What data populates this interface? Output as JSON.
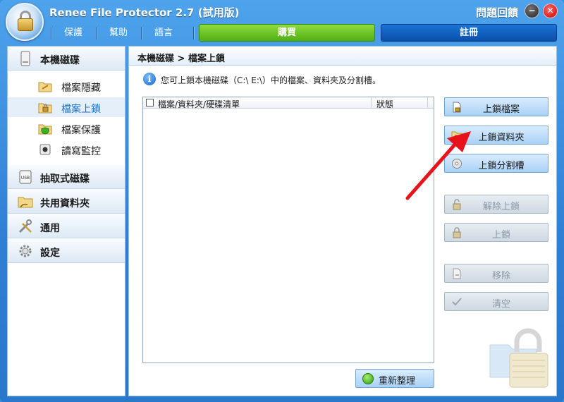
{
  "window": {
    "title": "Renee File Protector 2.7 (試用版)",
    "help_link": "問題回饋",
    "minimize_glyph": "−",
    "close_glyph": "✕"
  },
  "menu": {
    "items": [
      "保護",
      "幫助",
      "語言"
    ],
    "buy_label": "購買",
    "register_label": "註冊"
  },
  "sidebar": {
    "groups": [
      {
        "label": "本機磁碟",
        "icon": "hard-disk-icon"
      },
      {
        "label": "抽取式磁碟",
        "icon": "usb-drive-icon"
      },
      {
        "label": "共用資料夾",
        "icon": "shared-folder-icon"
      },
      {
        "label": "通用",
        "icon": "tools-icon"
      },
      {
        "label": "設定",
        "icon": "gear-icon"
      }
    ],
    "sub_items": [
      {
        "label": "檔案隱藏",
        "icon": "hidden-folder-icon"
      },
      {
        "label": "檔案上鎖",
        "icon": "locked-folder-icon",
        "active": true
      },
      {
        "label": "檔案保護",
        "icon": "protected-folder-icon"
      },
      {
        "label": "讀寫監控",
        "icon": "monitor-icon"
      }
    ]
  },
  "main": {
    "breadcrumb": "本機磁碟 > 檔案上鎖",
    "info_text": "您可上鎖本機磁碟（C:\\ E:\\）中的檔案、資料夾及分割槽。",
    "list": {
      "col_name": "檔案/資料夾/硬碟清單",
      "col_status": "狀態",
      "rows": []
    },
    "refresh_label": "重新整理",
    "actions": [
      {
        "label": "上鎖檔案",
        "enabled": true,
        "icon": "file-icon"
      },
      {
        "label": "上鎖資料夾",
        "enabled": true,
        "icon": "folder-icon"
      },
      {
        "label": "上鎖分割槽",
        "enabled": true,
        "icon": "disc-icon"
      },
      {
        "label": "解除上鎖",
        "enabled": false,
        "icon": "unlock-icon"
      },
      {
        "label": "上鎖",
        "enabled": false,
        "icon": "lock-icon"
      },
      {
        "label": "移除",
        "enabled": false,
        "icon": "remove-icon"
      },
      {
        "label": "清空",
        "enabled": false,
        "icon": "check-icon"
      }
    ]
  },
  "colors": {
    "titlebar": "#3b8ddd",
    "buy": "#5fbf1c",
    "register": "#0c56b0",
    "active_nav": "#1a6fc4",
    "annotation_arrow": "#e8121a"
  }
}
